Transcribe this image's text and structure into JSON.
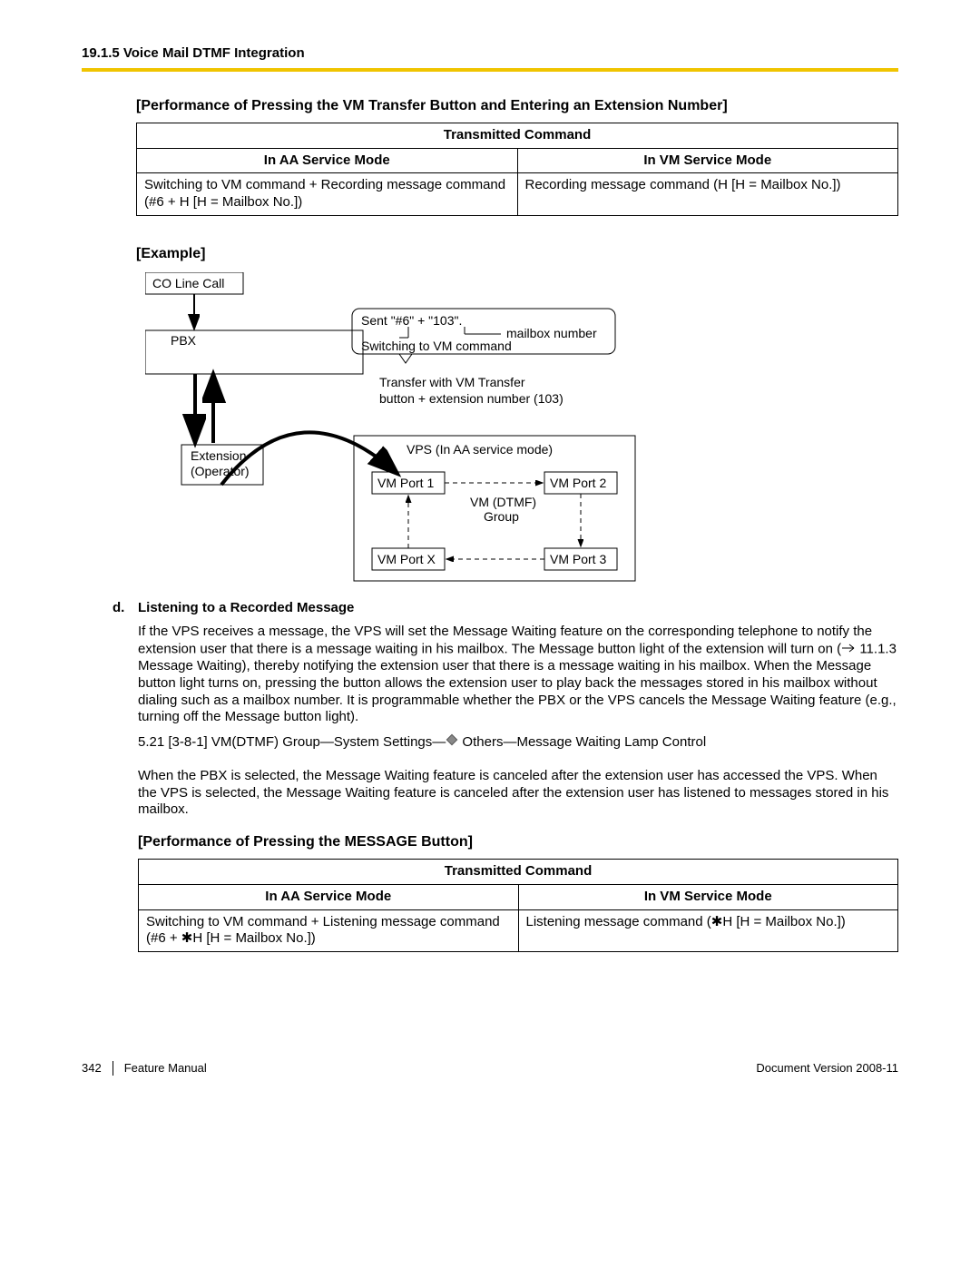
{
  "header": {
    "section": "19.1.5 Voice Mail DTMF Integration"
  },
  "section1": {
    "title": "[Performance of Pressing the VM Transfer Button and Entering an Extension Number]",
    "table": {
      "h_top": "Transmitted Command",
      "h_a": "In AA Service Mode",
      "h_v": "In VM Service Mode",
      "cell_a": "Switching to VM command + Recording message command (#6 + H [H = Mailbox No.])",
      "cell_v": "Recording message command (H [H = Mailbox No.])"
    }
  },
  "example": {
    "title": "[Example]",
    "co_line": "CO Line Call",
    "pbx": "PBX",
    "sent_prefix": "Sent ",
    "sent_code": "\"#6\" + \"103\"",
    "sent_suffix": ".",
    "mailbox_number": "mailbox number",
    "switch_vm": "Switching to VM command",
    "transfer1": "Transfer with VM Transfer",
    "transfer2": "button + extension number (103)",
    "ext1": "Extension",
    "ext2": "(Operator)",
    "vps_top": "VPS (In AA service mode)",
    "port1": "VM Port 1",
    "port2": "VM Port 2",
    "port3": "VM Port 3",
    "portx": "VM Port X",
    "vm_dtmf1": "VM (DTMF)",
    "vm_dtmf2": "Group"
  },
  "item_d": {
    "marker": "d.",
    "heading": "Listening to a Recorded Message",
    "p1a": "If the VPS receives a message, the VPS will set the Message Waiting feature on the corresponding telephone to notify the extension user that there is a message waiting in his mailbox. The Message button light of the extension will turn on (",
    "p1b": " 11.1.3  Message Waiting), thereby notifying the extension user that there is a message waiting in his mailbox. When the Message button light turns on, pressing the button allows the extension user to play back the messages stored in his mailbox without dialing such as a mailbox number. It is programmable whether the PBX or the VPS cancels the Message Waiting feature (e.g., turning off the Message button light).",
    "p2a": "5.21  [3-8-1] VM(DTMF) Group—System Settings—",
    "p2b": " Others—Message Waiting Lamp Control",
    "p3": "When the PBX is selected, the Message Waiting feature is canceled after the extension user has accessed the VPS. When the VPS is selected, the Message Waiting feature is canceled after the extension user has listened to messages stored in his mailbox."
  },
  "section2": {
    "title": "[Performance of Pressing the MESSAGE Button]",
    "table": {
      "h_top": "Transmitted Command",
      "h_a": "In AA Service Mode",
      "h_v": "In VM Service Mode",
      "cell_a": "Switching to VM command + Listening message command\n(#6 + ✱H [H = Mailbox No.])",
      "cell_v": "Listening message command (✱H [H = Mailbox No.])"
    }
  },
  "footer": {
    "page": "342",
    "title": "Feature Manual",
    "version": "Document Version  2008-11"
  }
}
